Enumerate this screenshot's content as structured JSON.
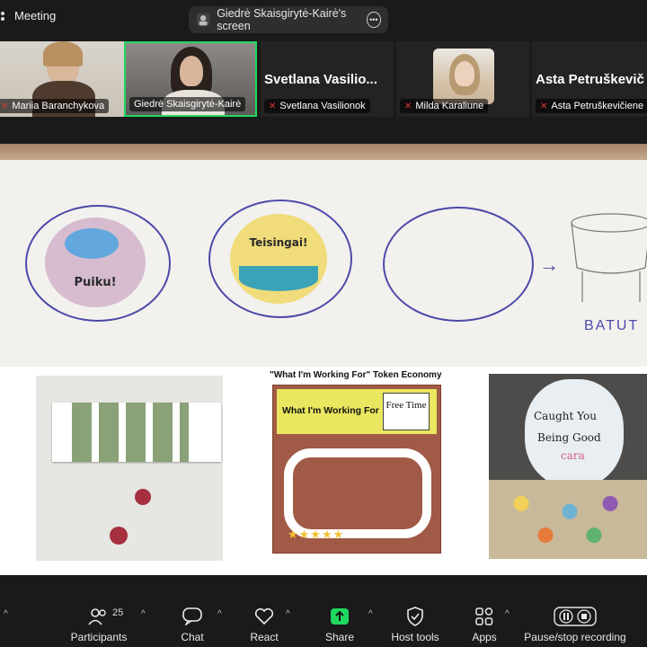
{
  "topbar": {
    "meeting_label": "Meeting",
    "share_label": "Giedrė Skaisgirytė-Kairė's screen"
  },
  "participants": [
    {
      "name": "Mariia Baranchykova",
      "muted": true,
      "video": true
    },
    {
      "name": "Giedrė Skaisgirytė-Kairė",
      "muted": false,
      "video": true,
      "active_speaker": true
    },
    {
      "name": "Svetlana Vasilionok",
      "display_name": "Svetlana  Vasilio...",
      "muted": true,
      "video": false
    },
    {
      "name": "Milda Karaliune",
      "muted": true,
      "video": false
    },
    {
      "name": "Asta Petruškevičiene",
      "display_name": "Asta  Petruškevič",
      "muted": true,
      "video": false
    }
  ],
  "shared_screen": {
    "token1_text": "Puiku!",
    "token2_text": "Teisingai!",
    "board_word": "BATUT",
    "token_economy_caption": "\"What I'm Working For\" Token Economy",
    "board_title": "What I'm Working For",
    "board_freebox": "Free Time",
    "jar_text_1": "Caught You",
    "jar_text_2": "Being Good",
    "jar_text_3": "cara"
  },
  "toolbar": {
    "participants_label": "Participants",
    "participants_count": "25",
    "chat_label": "Chat",
    "react_label": "React",
    "share_label": "Share",
    "host_tools_label": "Host tools",
    "apps_label": "Apps",
    "record_label": "Pause/stop recording"
  },
  "colors": {
    "active_speaker_border": "#1fd85e",
    "share_green": "#1fd85e",
    "muted_red": "#e0353a"
  }
}
